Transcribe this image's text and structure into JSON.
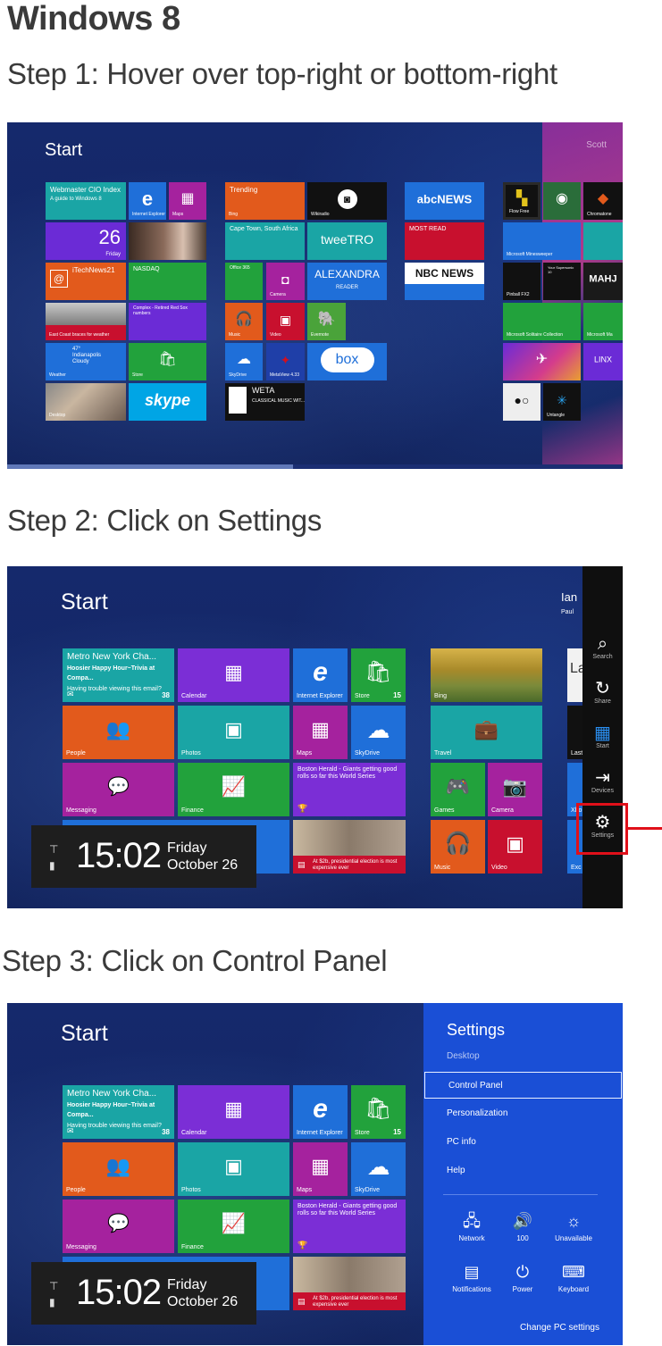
{
  "heading": "Windows 8",
  "steps": [
    {
      "title": "Step 1: Hover over top-right or bottom-right"
    },
    {
      "title": "Step 2: Click on Settings"
    },
    {
      "title": "Step 3: Click on Control Panel"
    }
  ],
  "shot1": {
    "start_label": "Start",
    "user_name": "Scott",
    "tiles": {
      "webmaster": "Webmaster CIO Index",
      "webmaster_sub": "A guide to Windows 8",
      "internet_explorer": "Internet Explorer",
      "maps": "Maps",
      "trending": "Trending",
      "bing": "Bing",
      "wikiradio": "Wikiradio",
      "abc_news": "abcNEWS",
      "date_num": "26",
      "date_day": "Friday",
      "cape_town": "Cape Town, South Africa",
      "tweetro": "tweeTRO",
      "most_read": "MOST READ",
      "itechnews": "iTechNews21",
      "nasdaq": "NASDAQ",
      "office": "Office 365",
      "camera": "Camera",
      "alexandra": "ALEXANDRA",
      "alexandra_sub": "READER",
      "nbc_news": "NBC NEWS",
      "complex": "Complex - Retired Red Sox numbers",
      "east_coast": "East Coast braces for weather",
      "music": "Music",
      "video": "Video",
      "evernote": "Evernote",
      "weather_temp": "47°",
      "weather_city": "Indianapolis",
      "weather_cond": "Cloudy",
      "weather": "Weather",
      "store": "Store",
      "skydrive": "SkyDrive",
      "mandela": "MetaView 4.33",
      "box": "box",
      "skype": "skype",
      "weta": "WETA",
      "weta_sub": "CLASSICAL MUSIC WIT...",
      "desktop": "Desktop",
      "flow_free": "Flow Free",
      "chromatone": "Chromatone",
      "minesweeper": "Microsoft Minesweeper",
      "pinball": "Pinball FX2",
      "your_supersonic": "Your Supersonic 10",
      "mahjong": "MAHJ",
      "solitaire": "Microsoft Solitaire Collection",
      "microsoft_mahjong": "Microsoft Ma",
      "linx": "LINX",
      "untangle": "Untangle"
    }
  },
  "shot2": {
    "start_label": "Start",
    "user_first": "Ian",
    "user_last": "Paul",
    "tiles": {
      "metro": "Metro New York Cha...",
      "metro_sub1": "Hoosier Happy Hour~Trivia at Compa...",
      "metro_sub2": "Having trouble viewing this email?",
      "metro_count": "38",
      "calendar": "Calendar",
      "internet_explorer": "Internet Explorer",
      "store": "Store",
      "store_count": "15",
      "bing": "Bing",
      "people": "People",
      "photos": "Photos",
      "maps": "Maps",
      "skydrive": "SkyDrive",
      "travel": "Travel",
      "messaging": "Messaging",
      "finance": "Finance",
      "boston": "Boston Herald - Giants getting good rolls so far this World Series",
      "games": "Games",
      "camera": "Camera",
      "election": "At $2b, presidential election is most expensive ever",
      "music": "Music",
      "video": "Video",
      "la_partial": "La",
      "last_partial": "Last",
      "xbox_partial": "Xbo",
      "exc_partial": "Exc"
    },
    "clock": {
      "time": "15:02",
      "day": "Friday",
      "date": "October 26"
    },
    "charms": [
      {
        "icon": "search-icon",
        "label": "Search"
      },
      {
        "icon": "share-icon",
        "label": "Share"
      },
      {
        "icon": "windows-icon",
        "label": "Start"
      },
      {
        "icon": "devices-icon",
        "label": "Devices"
      },
      {
        "icon": "gear-icon",
        "label": "Settings"
      }
    ],
    "highlight_color": "#e0101a"
  },
  "shot3": {
    "start_label": "Start",
    "tiles": {
      "metro": "Metro New York Cha...",
      "metro_sub1": "Hoosier Happy Hour~Trivia at Compa...",
      "metro_sub2": "Having trouble viewing this email?",
      "metro_count": "38",
      "calendar": "Calendar",
      "internet_explorer": "Internet Explorer",
      "store": "Store",
      "store_count": "15",
      "people": "People",
      "photos": "Photos",
      "maps": "Maps",
      "skydrive": "SkyDrive",
      "messaging": "Messaging",
      "finance": "Finance",
      "boston": "Boston Herald - Giants getting good rolls so far this World Series",
      "election": "At $2b, presidential election is most expensive ever"
    },
    "clock": {
      "time": "15:02",
      "day": "Friday",
      "date": "October 26"
    },
    "settings_panel": {
      "title": "Settings",
      "subtitle": "Desktop",
      "items": [
        "Control Panel",
        "Personalization",
        "PC info",
        "Help"
      ],
      "quick": [
        {
          "icon": "network-icon",
          "label": "Network"
        },
        {
          "icon": "volume-icon",
          "label": "100"
        },
        {
          "icon": "brightness-icon",
          "label": "Unavailable"
        },
        {
          "icon": "notifications-icon",
          "label": "Notifications"
        },
        {
          "icon": "power-icon",
          "label": "Power"
        },
        {
          "icon": "keyboard-icon",
          "label": "Keyboard"
        }
      ],
      "change": "Change PC settings",
      "panel_color": "#1a4fd6"
    }
  }
}
